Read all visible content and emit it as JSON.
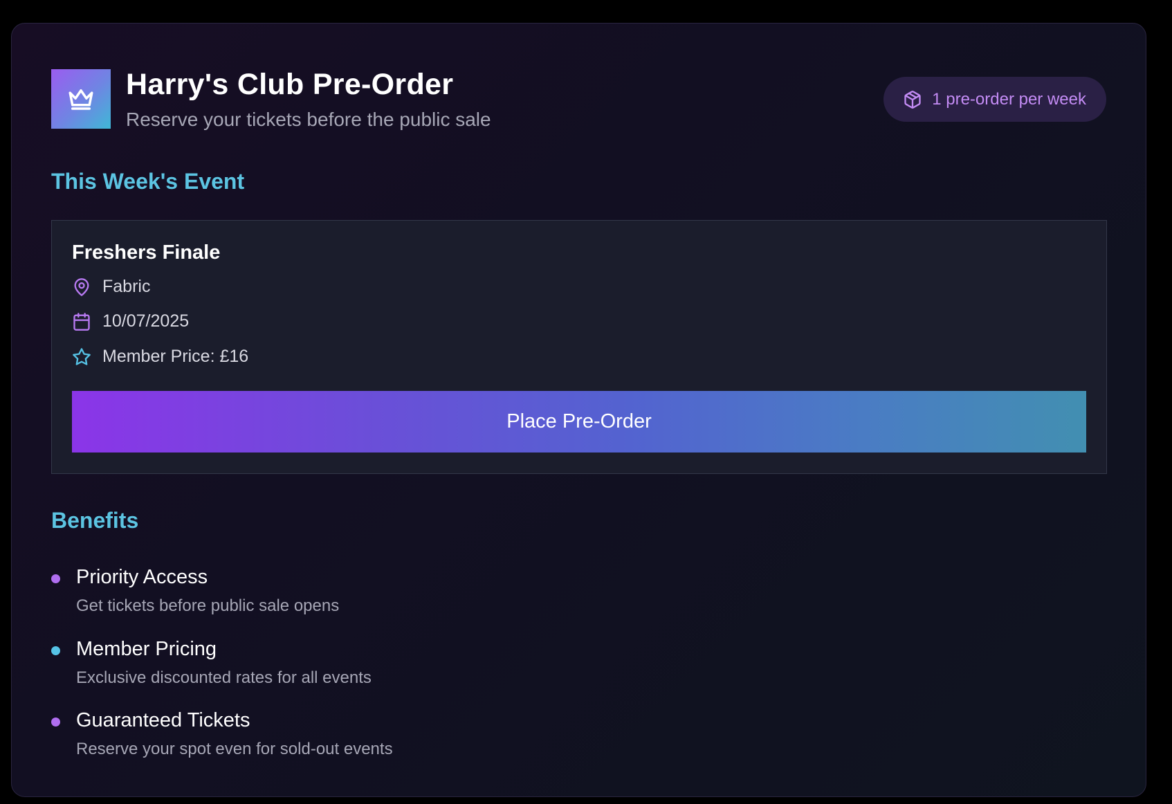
{
  "header": {
    "title": "Harry's Club Pre-Order",
    "subtitle": "Reserve your tickets before the public sale",
    "logo_icon": "crown-icon",
    "badge": {
      "icon": "package-icon",
      "label": "1 pre-order per week"
    }
  },
  "event_section": {
    "title": "This Week's Event",
    "event": {
      "name": "Freshers Finale",
      "venue": "Fabric",
      "date": "10/07/2025",
      "price": "Member Price: £16"
    },
    "cta_label": "Place Pre-Order"
  },
  "benefits_section": {
    "title": "Benefits",
    "items": [
      {
        "title": "Priority Access",
        "description": "Get tickets before public sale opens",
        "dot_color": "#b06ef0"
      },
      {
        "title": "Member Pricing",
        "description": "Exclusive discounted rates for all events",
        "dot_color": "#56c3e6"
      },
      {
        "title": "Guaranteed Tickets",
        "description": "Reserve your spot even for sold-out events",
        "dot_color": "#b06ef0"
      }
    ]
  },
  "colors": {
    "accent_purple": "#b06ef0",
    "accent_cyan": "#5cc4e2",
    "card_bg": "#1b1d2c"
  }
}
